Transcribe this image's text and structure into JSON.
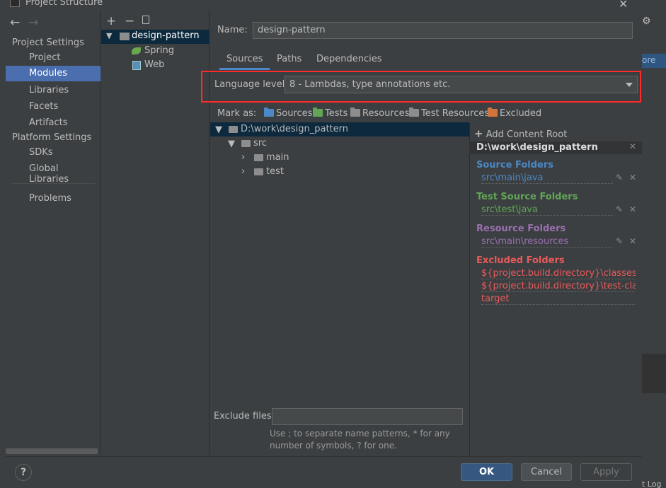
{
  "window": {
    "title": "Project Structure",
    "close_icon": "close-icon"
  },
  "background": {
    "right_badge": "ore",
    "bottom_right_text": "t Log"
  },
  "nav": {
    "back_icon": "arrow-left-icon",
    "forward_icon": "arrow-right-icon"
  },
  "sidebar": {
    "project_settings_header": "Project Settings",
    "project_items": [
      {
        "label": "Project",
        "selected": false
      },
      {
        "label": "Modules",
        "selected": true
      },
      {
        "label": "Libraries",
        "selected": false
      },
      {
        "label": "Facets",
        "selected": false
      },
      {
        "label": "Artifacts",
        "selected": false
      }
    ],
    "platform_settings_header": "Platform Settings",
    "platform_items": [
      {
        "label": "SDKs"
      },
      {
        "label": "Global Libraries"
      }
    ],
    "problems": "Problems"
  },
  "module_toolbar": {
    "add": "+",
    "remove": "−",
    "copy_icon": "copy-icon"
  },
  "module_tree": {
    "root": "design-pattern",
    "children": [
      "Spring",
      "Web"
    ]
  },
  "name": {
    "label": "Name:",
    "value": "design-pattern"
  },
  "tabs": [
    {
      "label": "Sources",
      "active": true
    },
    {
      "label": "Paths",
      "active": false
    },
    {
      "label": "Dependencies",
      "active": false
    }
  ],
  "language_level": {
    "label": "Language level:",
    "value": "8 - Lambdas, type annotations etc."
  },
  "mark_as": {
    "label": "Mark as:",
    "options": [
      {
        "label": "Sources",
        "color": "#4a88c7"
      },
      {
        "label": "Tests",
        "color": "#62a557"
      },
      {
        "label": "Resources",
        "color": "#8d8d8d"
      },
      {
        "label": "Test Resources",
        "color": "#8d8d8d"
      },
      {
        "label": "Excluded",
        "color": "#d3743c"
      }
    ]
  },
  "content_tree": {
    "root": "D:\\work\\design_pattern",
    "src": "src",
    "main": "main",
    "test": "test"
  },
  "content_root_panel": {
    "add_label": "Add Content Root",
    "root_path": "D:\\work\\design_pattern",
    "source_title": "Source Folders",
    "source_items": [
      "src\\main\\java"
    ],
    "test_title": "Test Source Folders",
    "test_items": [
      "src\\test\\java"
    ],
    "resource_title": "Resource Folders",
    "resource_items": [
      "src\\main\\resources"
    ],
    "excluded_title": "Excluded Folders",
    "excluded_items": [
      "${project.build.directory}\\classes",
      "${project.build.directory}\\test-classes",
      "target"
    ],
    "colors": {
      "source": "#4a88c7",
      "test": "#62a557",
      "resource": "#9a6fb0",
      "excluded": "#e85a5a"
    }
  },
  "exclude_files": {
    "label": "Exclude files:",
    "value": "",
    "help": "Use ; to separate name patterns, * for any number of symbols, ? for one."
  },
  "buttons": {
    "help": "?",
    "ok": "OK",
    "cancel": "Cancel",
    "apply": "Apply"
  }
}
